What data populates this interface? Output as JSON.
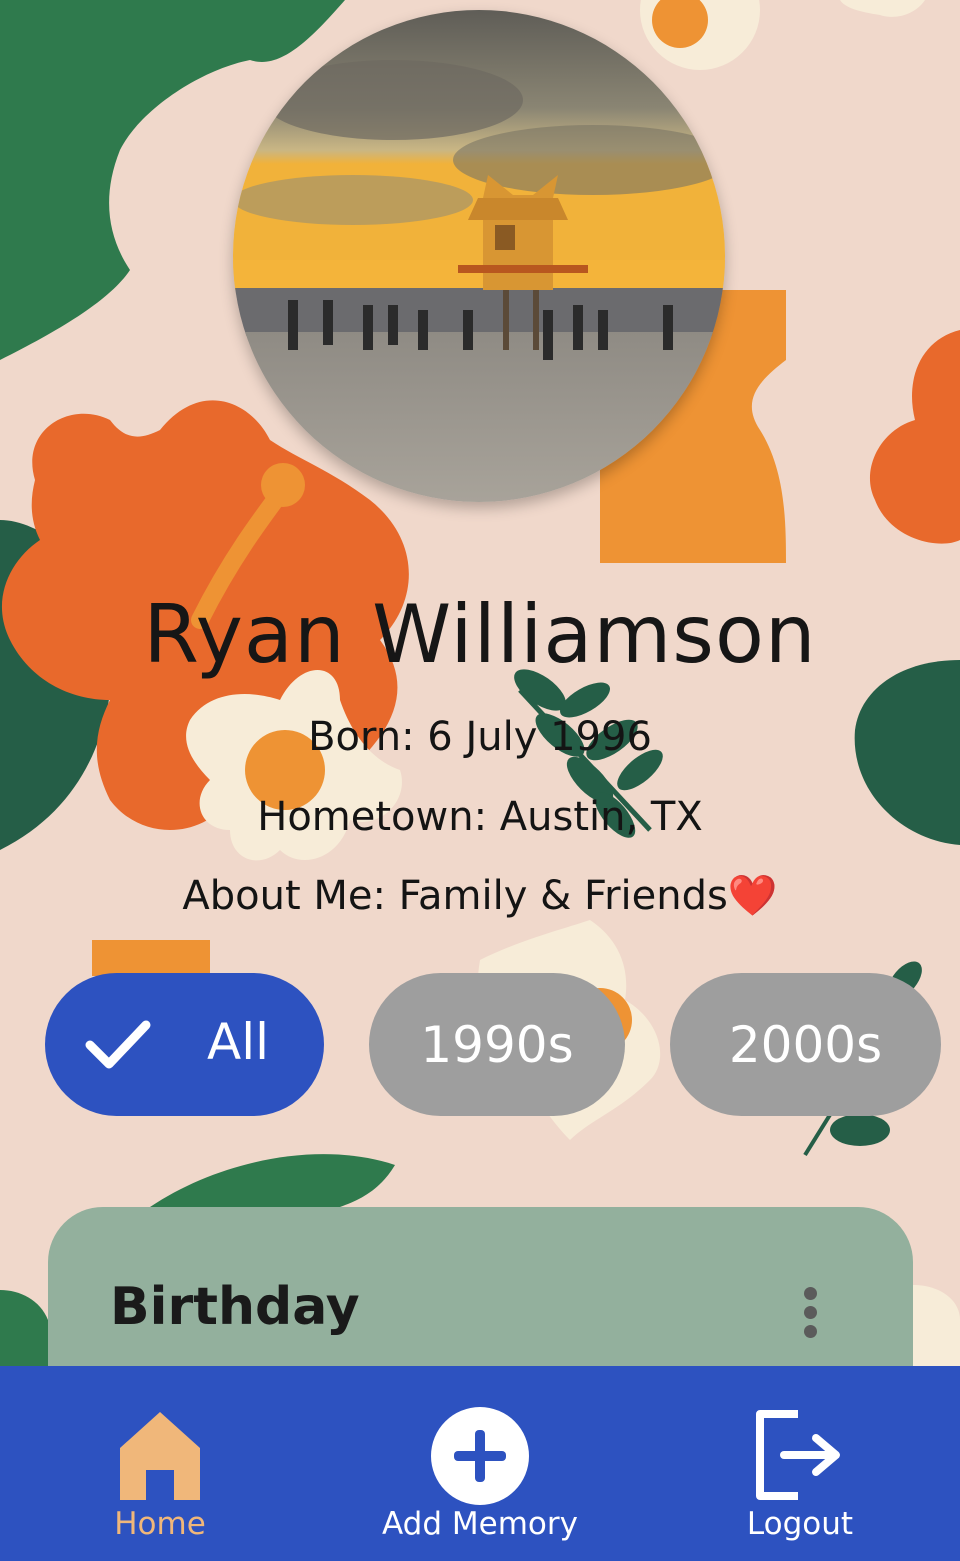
{
  "profile": {
    "name": "Ryan Williamson",
    "born": "Born: 6 July 1996",
    "hometown": "Hometown: Austin, TX",
    "about": "About Me: Family & Friends",
    "about_emoji": "❤️"
  },
  "filters": {
    "all": "All",
    "nineties": "1990s",
    "two_thousands": "2000s",
    "selected": "All"
  },
  "memory_card": {
    "title": "Birthday"
  },
  "nav": {
    "home": "Home",
    "add_memory": "Add Memory",
    "logout": "Logout"
  },
  "colors": {
    "background": "#f0d8cb",
    "primary_blue": "#2d52c0",
    "chip_gray": "#9e9e9e",
    "card_green": "#93b09d",
    "home_active": "#f0b77a",
    "hibiscus_orange": "#e8692c",
    "leaf_green": "#2f7a4d"
  }
}
